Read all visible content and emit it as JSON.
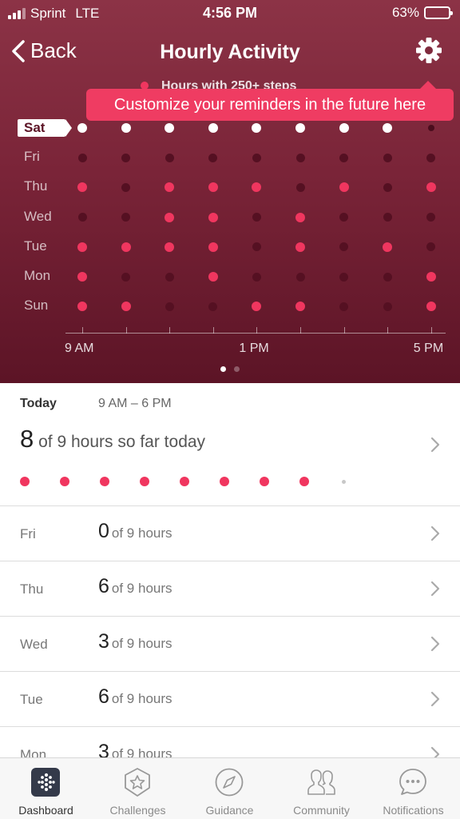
{
  "status_bar": {
    "carrier": "Sprint",
    "network": "LTE",
    "time": "4:56 PM",
    "battery_percent": "63%",
    "battery_level": 0.63
  },
  "nav": {
    "back_label": "Back",
    "title": "Hourly Activity"
  },
  "chart": {
    "legend_label": "Hours with 250+ steps",
    "tooltip": "Customize your reminders in the future here",
    "days": [
      "Sat",
      "Fri",
      "Thu",
      "Wed",
      "Tue",
      "Mon",
      "Sun"
    ],
    "selected_day": "Sat",
    "hours": [
      "9 AM",
      "10 AM",
      "11 AM",
      "12 PM",
      "1 PM",
      "2 PM",
      "3 PM",
      "4 PM",
      "5 PM"
    ],
    "axis_labels": [
      "9 AM",
      "1 PM",
      "5 PM"
    ],
    "grid": [
      [
        1,
        1,
        1,
        1,
        1,
        1,
        1,
        1,
        0
      ],
      [
        0,
        0,
        0,
        0,
        0,
        0,
        0,
        0,
        0
      ],
      [
        1,
        0,
        1,
        1,
        1,
        0,
        1,
        0,
        1
      ],
      [
        0,
        0,
        1,
        1,
        0,
        1,
        0,
        0,
        0
      ],
      [
        1,
        1,
        1,
        1,
        0,
        1,
        0,
        1,
        0
      ],
      [
        1,
        0,
        0,
        1,
        0,
        0,
        0,
        0,
        1
      ],
      [
        1,
        1,
        0,
        0,
        1,
        1,
        0,
        0,
        1
      ]
    ],
    "page_count": 2,
    "current_page": 1,
    "colors": {
      "active": "#f0365f",
      "inactive": "#551022",
      "today": "#ffffff"
    }
  },
  "today": {
    "label": "Today",
    "range": "9 AM – 6 PM",
    "count": "8",
    "summary_text": "of 9 hours so far today",
    "hour_dots": [
      1,
      1,
      1,
      1,
      1,
      1,
      1,
      1,
      0
    ]
  },
  "history": [
    {
      "day": "Fri",
      "count": "0",
      "text": "of 9 hours"
    },
    {
      "day": "Thu",
      "count": "6",
      "text": "of 9 hours"
    },
    {
      "day": "Wed",
      "count": "3",
      "text": "of 9 hours"
    },
    {
      "day": "Tue",
      "count": "6",
      "text": "of 9 hours"
    },
    {
      "day": "Mon",
      "count": "3",
      "text": "of 9 hours"
    }
  ],
  "tabbar": {
    "tabs": [
      {
        "label": "Dashboard",
        "icon": "dashboard-icon",
        "active": true
      },
      {
        "label": "Challenges",
        "icon": "star-badge-icon",
        "active": false
      },
      {
        "label": "Guidance",
        "icon": "compass-icon",
        "active": false
      },
      {
        "label": "Community",
        "icon": "people-icon",
        "active": false
      },
      {
        "label": "Notifications",
        "icon": "chat-bubble-icon",
        "active": false
      }
    ]
  }
}
